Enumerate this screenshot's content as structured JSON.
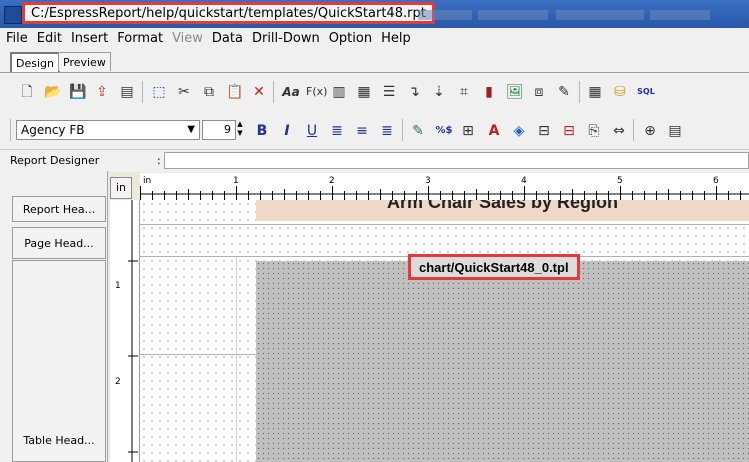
{
  "window": {
    "title_path": "C:/EspressReport/help/quickstart/templates/QuickStart48.rpt"
  },
  "menu": [
    "File",
    "Edit",
    "Insert",
    "Format",
    "View",
    "Data",
    "Drill-Down",
    "Option",
    "Help"
  ],
  "tabs": [
    "Design",
    "Preview"
  ],
  "toolbar1_icons": [
    "new-file-icon",
    "open-folder-icon",
    "save-icon",
    "export-icon",
    "page-setup-icon",
    "select-icon",
    "cut-icon",
    "copy-icon",
    "paste-icon",
    "delete-icon",
    "text-icon",
    "formula-icon",
    "column-icon",
    "report-icon",
    "table-icon",
    "arrow-icon",
    "pointer-icon",
    "select-region-icon",
    "chart-icon",
    "image-icon",
    "sub-report-icon",
    "notes-icon",
    "grid-icon",
    "database-icon",
    "sql-icon"
  ],
  "toolbar2_icons": [
    "bold-icon",
    "italic-icon",
    "underline-icon",
    "align-left-icon",
    "align-center-icon",
    "align-right-icon",
    "pen-icon",
    "percent-dollar-icon",
    "number-format-icon",
    "font-color-icon",
    "fill-color-icon",
    "border-icon",
    "border-color-icon",
    "page-break-icon",
    "fit-width-icon",
    "resize-icon",
    "properties-icon"
  ],
  "format": {
    "font_name": "Agency FB",
    "font_size": "9"
  },
  "designer": {
    "label": "Report Designer",
    "colon": ":"
  },
  "sections": {
    "report_header": "Report Hea...",
    "page_header": "Page Head...",
    "table_header": "Table Head..."
  },
  "ruler": {
    "unit": "in",
    "top_labels": [
      "in",
      "1",
      "2",
      "3",
      "4",
      "5",
      "6"
    ],
    "left_labels": [
      "1",
      "2"
    ]
  },
  "report": {
    "title": "Arm Chair Sales by Region",
    "chart_template": "chart/QuickStart48_0.tpl"
  }
}
